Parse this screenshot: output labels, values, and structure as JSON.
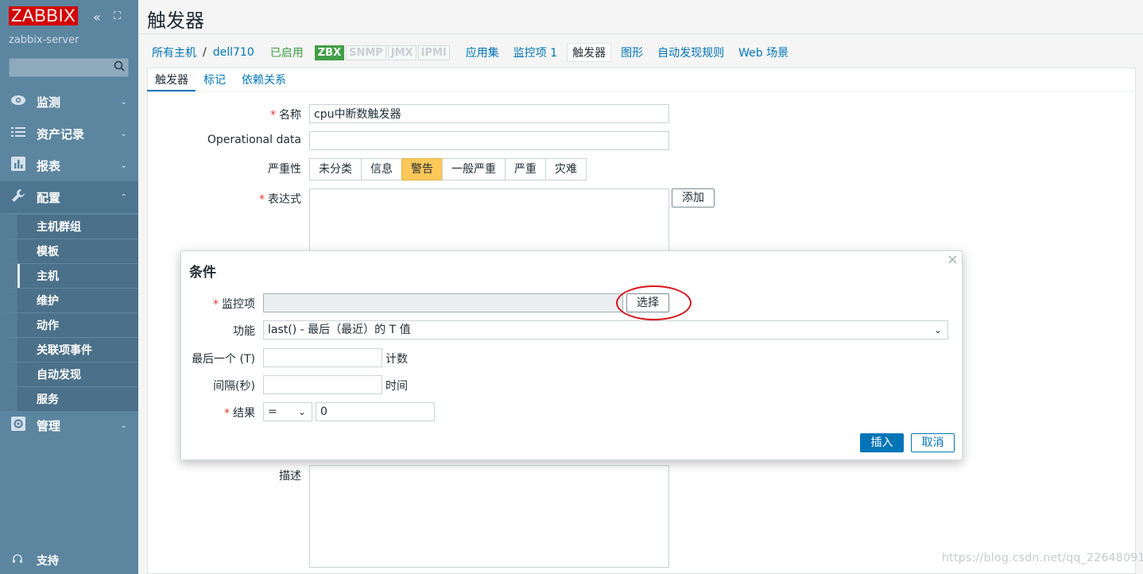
{
  "sidebar": {
    "logo": "ZABBIX",
    "collapse_icon": "«",
    "fullscreen_icon": "⛶",
    "server_name": "zabbix-server",
    "search_placeholder": "",
    "menus": [
      {
        "label": "监测",
        "icon": "eye"
      },
      {
        "label": "资产记录",
        "icon": "list"
      },
      {
        "label": "报表",
        "icon": "bar-chart"
      },
      {
        "label": "配置",
        "icon": "wrench"
      },
      {
        "label": "管理",
        "icon": "gear"
      }
    ],
    "submenu": [
      "主机群组",
      "模板",
      "主机",
      "维护",
      "动作",
      "关联项事件",
      "自动发现",
      "服务"
    ],
    "support": "支持"
  },
  "page": {
    "title": "触发器"
  },
  "host_nav": {
    "all_hosts": "所有主机",
    "separator": "/",
    "host": "dell710",
    "status": "已启用",
    "tags": [
      "ZBX",
      "SNMP",
      "JMX",
      "IPMI"
    ],
    "items": [
      "应用集",
      "监控项 1",
      "触发器",
      "图形",
      "自动发现规则",
      "Web 场景"
    ]
  },
  "tabs": [
    "触发器",
    "标记",
    "依赖关系"
  ],
  "form": {
    "name_label": "名称",
    "name_value": "cpu中断数触发器",
    "opdata_label": "Operational data",
    "opdata_value": "",
    "severity_label": "严重性",
    "severities": [
      "未分类",
      "信息",
      "警告",
      "一般严重",
      "严重",
      "灾难"
    ],
    "severity_selected": "警告",
    "expression_label": "表达式",
    "add_button": "添加",
    "description_label": "描述",
    "required_mark": "*"
  },
  "modal": {
    "title": "条件",
    "close": "×",
    "item_label": "监控项",
    "item_value": "",
    "select_button": "选择",
    "function_label": "功能",
    "function_value": "last() - 最后（最近）的 T 值",
    "last_t_label": "最后一个 (T)",
    "last_t_value": "",
    "last_t_suffix": "计数",
    "interval_label": "间隔(秒)",
    "interval_value": "",
    "interval_suffix": "时间",
    "result_label": "结果",
    "result_operator": "=",
    "result_value": "0",
    "insert_button": "插入",
    "cancel_button": "取消"
  },
  "watermark": "https://blog.csdn.net/qq_22648091"
}
